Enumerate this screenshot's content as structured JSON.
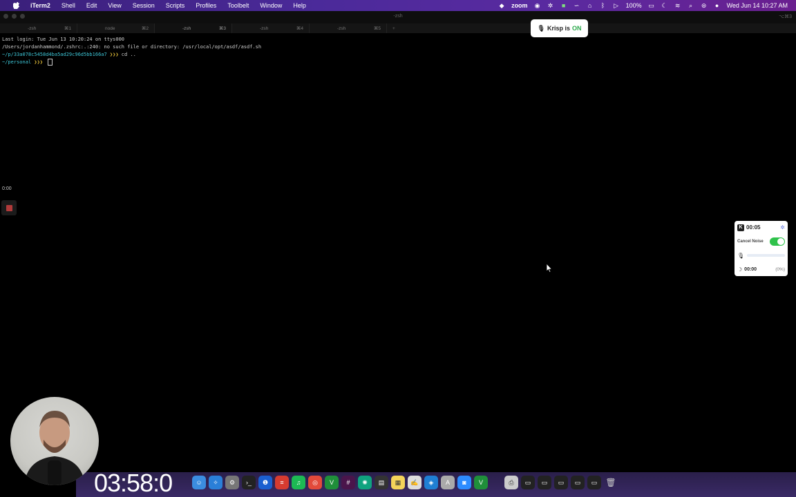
{
  "menubar": {
    "apple": "",
    "items": [
      "iTerm2",
      "Shell",
      "Edit",
      "View",
      "Session",
      "Scripts",
      "Profiles",
      "Toolbelt",
      "Window",
      "Help"
    ],
    "status": {
      "zoom": "zoom",
      "battery": "100%",
      "datetime": "Wed Jun 14  10:27 AM"
    }
  },
  "window": {
    "title": "-zsh",
    "shortcut": "⌥⌘3",
    "tabs": [
      {
        "label": "-zsh",
        "shortcut": "⌘1"
      },
      {
        "label": "node",
        "shortcut": "⌘2"
      },
      {
        "label": "-zsh",
        "shortcut": "⌘3"
      },
      {
        "label": "-zsh",
        "shortcut": "⌘4"
      },
      {
        "label": "-zsh",
        "shortcut": "⌘5"
      }
    ],
    "new_tab": "+"
  },
  "terminal": {
    "line1": "Last login: Tue Jun 13 10:20:24 on ttys000",
    "line2": "/Users/jordanhammond/.zshrc:.:240: no such file or directory: /usr/local/opt/asdf/asdf.sh",
    "line3_path": "~/p/33a078c5458d4ba5ad29c96d5bb166a7",
    "line3_prompt": " ❯❯❯ ",
    "line3_cmd": "cd ..",
    "line4_path": "~/personal",
    "line4_prompt": " ❯❯❯ "
  },
  "krisp_toast": {
    "label": "Krisp is",
    "state": "ON"
  },
  "recorder": {
    "time": "0:00"
  },
  "krisp_widget": {
    "timer": "00:05",
    "cancel_noise": "Cancel Noise",
    "bottom_timer": "00:00",
    "bottom_pct": "(0%)"
  },
  "overlay": {
    "big_timer": "03:58:0"
  },
  "colors": {
    "menubar": "#4b2a9a",
    "toggle_on": "#2fc24b",
    "path": "#3ec7d8"
  }
}
